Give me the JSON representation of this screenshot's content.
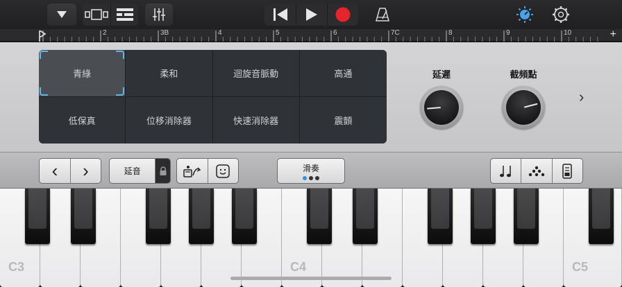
{
  "colors": {
    "record": "#e5242c",
    "accent": "#4aa3e6",
    "selected_outline": "#5ab7e8"
  },
  "toolbar": {
    "icons": [
      "dropdown-triangle-icon",
      "view-tracks-icon",
      "view-list-icon",
      "mixer-icon",
      "rewind-icon",
      "play-icon",
      "record-icon",
      "metronome-icon",
      "master-volume-icon",
      "settings-gear-icon"
    ]
  },
  "ruler": {
    "marks": [
      "2",
      "3B",
      "4",
      "5",
      "6",
      "7C",
      "8",
      "9",
      "10"
    ],
    "add_label": "+"
  },
  "pads": [
    {
      "label": "青綠",
      "selected": true
    },
    {
      "label": "柔和"
    },
    {
      "label": "迴旋音脈動"
    },
    {
      "label": "高通"
    },
    {
      "label": "低保真"
    },
    {
      "label": "位移消除器"
    },
    {
      "label": "快速消除器"
    },
    {
      "label": "震顫"
    }
  ],
  "knobs": [
    {
      "label": "延遲",
      "value": 0.15
    },
    {
      "label": "截頻點",
      "value": 0.78
    }
  ],
  "more_chevron": "›",
  "midbar": {
    "octave_down": "‹",
    "octave_up": "›",
    "sustain_label": "延音",
    "glide_label": "滑奏",
    "glide_level": 1
  },
  "keyboard": {
    "note_labels": {
      "c3": "C3",
      "c4": "C4",
      "c5": "C5"
    }
  }
}
